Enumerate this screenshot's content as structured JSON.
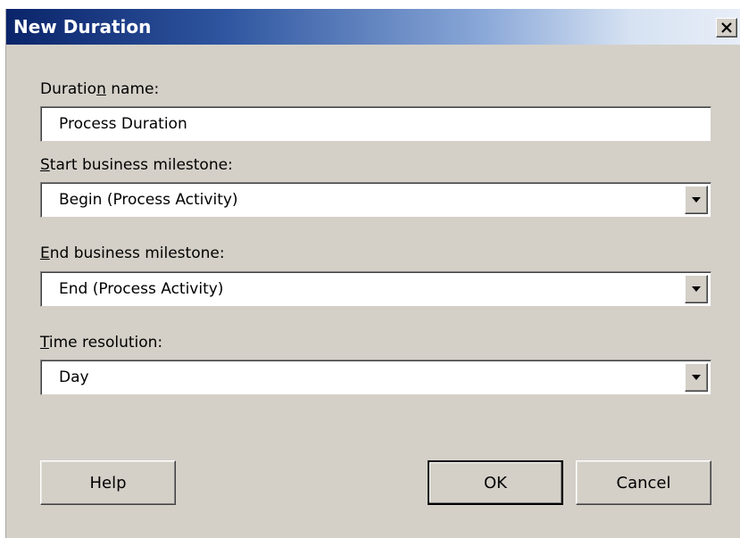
{
  "window": {
    "title": "New Duration",
    "close_icon": "close-icon"
  },
  "form": {
    "duration_name": {
      "label_pre": "Duratio",
      "label_mnemonic": "n",
      "label_post": " name:",
      "value": "Process Duration"
    },
    "start_milestone": {
      "label_pre": "",
      "label_mnemonic": "S",
      "label_post": "tart business milestone:",
      "value": "Begin (Process Activity)"
    },
    "end_milestone": {
      "label_pre": "",
      "label_mnemonic": "E",
      "label_post": "nd business milestone:",
      "value": "End (Process Activity)"
    },
    "time_resolution": {
      "label_pre": "",
      "label_mnemonic": "T",
      "label_post": "ime resolution:",
      "value": "Day"
    }
  },
  "buttons": {
    "help": "Help",
    "ok": "OK",
    "cancel": "Cancel"
  },
  "colors": {
    "titlebar_start": "#0a246a",
    "titlebar_end": "#e8eef8",
    "dialog_face": "#d4d0c8",
    "field_bg": "#ffffff"
  }
}
